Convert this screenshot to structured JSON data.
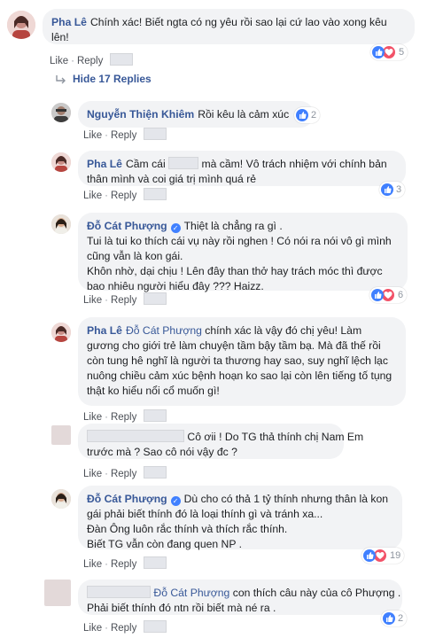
{
  "ui": {
    "like": "Like",
    "reply": "Reply",
    "dot": "·"
  },
  "hide_replies": "Hide 17 Replies",
  "comments": [
    {
      "name": "Pha Lê",
      "lines": [
        "Chính xác! Biết ngta có ng yêu rồi sao lại cứ lao vào xong kêu",
        "lên!"
      ],
      "reaction_count": "5"
    },
    {
      "name": "Nguyễn Thiện Khiêm",
      "lines": [
        "Rồi kêu là cảm xúc"
      ],
      "reaction_count": "2"
    },
    {
      "name": "Pha Lê",
      "lines_a": "Cầm cái",
      "lines_b": "mà cầm! Vô trách nhiệm với chính bản",
      "lines": [
        "thân mình và coi giá trị mình quá rẻ"
      ],
      "reaction_count": "3"
    },
    {
      "name": "Đỗ Cát Phượng",
      "lines": [
        "Thiệt là chẳng ra gì .",
        "Tui là tui ko thích cái vụ này rồi nghen ! Có nói ra nói vô gì mình",
        "cũng vẫn là kon gái.",
        "Khôn nhờ, dại chịu ! Lên đây than thở hay trách móc thì được",
        "bao nhiêu người hiểu đây ??? Haizz."
      ],
      "reaction_count": "6"
    },
    {
      "name": "Pha Lê",
      "tag": "Đỗ Cát Phượng",
      "lines": [
        "chính xác là vậy đó chị yêu! Làm",
        "gương cho giới trẻ làm chuyện tầm bậy tầm bạ. Mà đã thế rồi",
        "còn tung hê nghĩ là người ta thương hay sao, suy nghĩ lệch lạc",
        "nuông chiều cảm xúc bệnh hoạn ko sao lại còn lên tiếng tố tụng",
        "thật ko hiểu nổi cổ muốn gì!"
      ],
      "reaction_count": ""
    },
    {
      "name": "",
      "lines": [
        "Cô ơii ! Do TG thả thính chị Nam Em",
        "trước mà ? Sao cô nói vậy đc ?"
      ],
      "reaction_count": ""
    },
    {
      "name": "Đỗ Cát Phượng",
      "lines": [
        "Dù cho có thả 1 tỷ thính nhưng thân là kon",
        "gái phải biết thính đó là loại thính gì và tránh xa...",
        "Đàn Ông luôn rắc thính và thích rắc thính.",
        "Biết TG vẫn còn đang quen NP ."
      ],
      "reaction_count": "19"
    },
    {
      "name": "",
      "tag": "Đỗ Cát Phượng",
      "lines": [
        "con thích câu này của cô Phượng .",
        "Phải biết thính đó ntn rồi biết mà né ra ."
      ],
      "reaction_count": "2"
    }
  ]
}
